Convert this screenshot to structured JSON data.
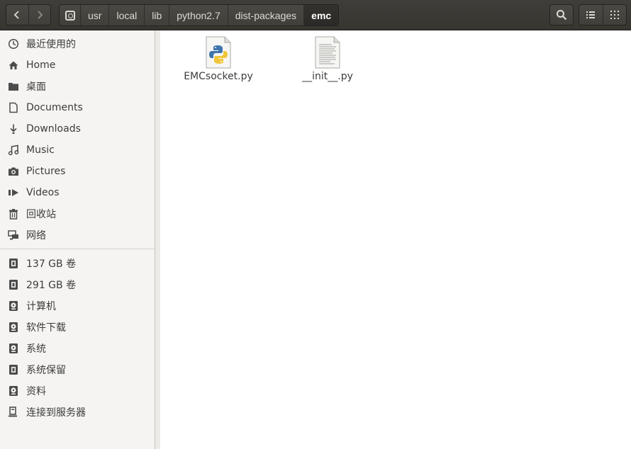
{
  "path": {
    "crumbs": [
      "usr",
      "local",
      "lib",
      "python2.7",
      "dist-packages",
      "emc"
    ]
  },
  "sidebar": {
    "places": [
      {
        "label": "最近使用的",
        "icon": "recent-clock-icon"
      },
      {
        "label": "Home",
        "icon": "home-icon"
      },
      {
        "label": "桌面",
        "icon": "folder-icon"
      },
      {
        "label": "Documents",
        "icon": "document-icon"
      },
      {
        "label": "Downloads",
        "icon": "download-arrow-icon"
      },
      {
        "label": "Music",
        "icon": "music-note-icon"
      },
      {
        "label": "Pictures",
        "icon": "camera-icon"
      },
      {
        "label": "Videos",
        "icon": "video-icon"
      },
      {
        "label": "回收站",
        "icon": "trash-icon"
      },
      {
        "label": "网络",
        "icon": "network-icon"
      }
    ],
    "devices": [
      {
        "label": "137 GB 卷",
        "icon": "drive-icon"
      },
      {
        "label": "291 GB 卷",
        "icon": "drive-icon"
      },
      {
        "label": "计算机",
        "icon": "disk-icon"
      },
      {
        "label": "软件下载",
        "icon": "disk-icon"
      },
      {
        "label": "系统",
        "icon": "disk-icon"
      },
      {
        "label": "系统保留",
        "icon": "drive-icon"
      },
      {
        "label": "资料",
        "icon": "disk-icon"
      },
      {
        "label": "连接到服务器",
        "icon": "server-icon"
      }
    ]
  },
  "files": [
    {
      "name": "EMCsocket.py",
      "icon": "python-file-icon"
    },
    {
      "name": "__init__.py",
      "icon": "text-file-icon"
    }
  ],
  "colors": {
    "headerbar": "#3c3b37",
    "sidebar_bg": "#f5f4f2",
    "text": "#3c3c3c"
  }
}
